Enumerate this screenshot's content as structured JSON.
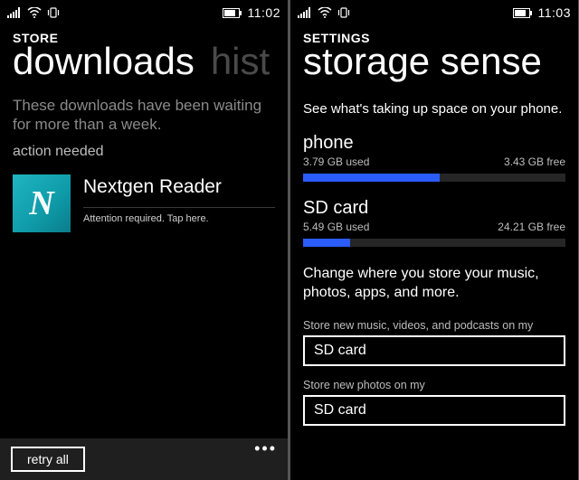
{
  "left": {
    "status": {
      "time": "11:02"
    },
    "header": "STORE",
    "pivot": {
      "active": "downloads",
      "inactive": "hist"
    },
    "waiting_msg": "These downloads have been waiting for more than a week.",
    "action_needed": "action needed",
    "app": {
      "icon_letter": "N",
      "name": "Nextgen Reader",
      "attention": "Attention required. Tap here."
    },
    "appbar": {
      "retry": "retry all"
    }
  },
  "right": {
    "status": {
      "time": "11:03"
    },
    "header": "SETTINGS",
    "pivot": {
      "active": "storage sense"
    },
    "description": "See what's taking up space on your phone.",
    "phone_storage": {
      "name": "phone",
      "used": "3.79 GB used",
      "free": "3.43 GB free",
      "fill_percent": 52
    },
    "sd_storage": {
      "name": "SD card",
      "used": "5.49 GB used",
      "free": "24.21 GB free",
      "fill_percent": 18
    },
    "change_desc": "Change where you store your music, photos, apps, and more.",
    "media_label": "Store new music, videos, and podcasts on my",
    "media_value": "SD card",
    "photos_label": "Store new photos on my",
    "photos_value": "SD card"
  }
}
